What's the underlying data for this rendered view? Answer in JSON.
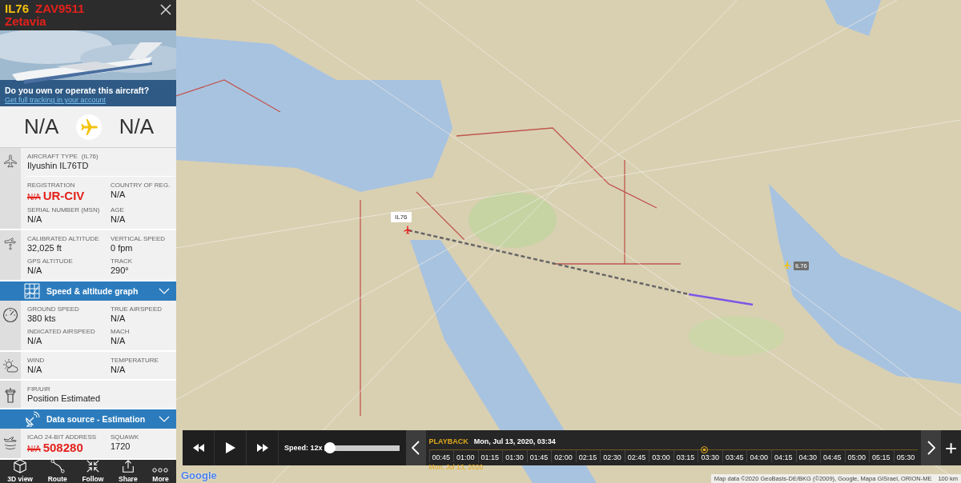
{
  "flight": {
    "aircraft_code": "IL76",
    "callsign": "ZAV9511",
    "airline": "Zetavia"
  },
  "banner": {
    "kind": "picture",
    "headline": "Do you own or operate this aircraft?",
    "link": "Get full tracking in your account"
  },
  "route": {
    "origin": "N/A",
    "destination": "N/A"
  },
  "sections": [
    {
      "kind": "details",
      "blocks": [
        [
          {
            "label": "AIRCRAFT TYPE",
            "label_extra": "(IL76)",
            "value": "Ilyushin IL76TD"
          }
        ],
        [
          {
            "label": "REGISTRATION",
            "struck": "N/A",
            "value": "UR-CIV",
            "edited": true
          },
          {
            "label": "COUNTRY OF REG.",
            "value": "N/A",
            "edited": false
          },
          {
            "label": "SERIAL NUMBER (MSN)",
            "value": "N/A",
            "edited": false
          },
          {
            "label": "AGE",
            "value": "N/A",
            "edited": false
          }
        ]
      ]
    },
    {
      "kind": "details",
      "blocks": [
        [
          {
            "label": "CALIBRATED ALTITUDE",
            "value": "32,025 ft",
            "edited": false
          },
          {
            "label": "VERTICAL SPEED",
            "value": "0 fpm",
            "edited": false
          },
          {
            "label": "GPS ALTITUDE",
            "value": "N/A",
            "edited": false
          },
          {
            "label": "TRACK",
            "value": "290°",
            "edited": false
          }
        ]
      ]
    },
    {
      "kind": "header",
      "title": "Speed & altitude graph"
    },
    {
      "kind": "details",
      "blocks": [
        [
          {
            "label": "GROUND SPEED",
            "value": "380 kts",
            "edited": false
          },
          {
            "label": "TRUE AIRSPEED",
            "value": "N/A",
            "edited": false
          },
          {
            "label": "INDICATED AIRSPEED",
            "value": "N/A",
            "edited": false
          },
          {
            "label": "MACH",
            "value": "N/A",
            "edited": false
          }
        ]
      ]
    },
    {
      "kind": "details",
      "blocks": [
        [
          {
            "label": "WIND",
            "value": "N/A",
            "edited": false
          },
          {
            "label": "TEMPERATURE",
            "value": "N/A",
            "edited": false
          }
        ]
      ]
    },
    {
      "kind": "details",
      "blocks": [
        [
          {
            "label": "FIR/UIR",
            "value": "Position Estimated"
          }
        ]
      ]
    },
    {
      "kind": "header",
      "title": "Data source - Estimation"
    },
    {
      "kind": "details",
      "blocks": [
        [
          {
            "label": "ICAO 24-BIT ADDRESS",
            "struck": "N/A",
            "value": "508280",
            "edited": true
          },
          {
            "label": "SQUAWK",
            "value": "1720",
            "edited": false
          }
        ]
      ]
    }
  ],
  "toolbar": [
    {
      "label": "3D view"
    },
    {
      "label": "Route"
    },
    {
      "label": "Follow"
    },
    {
      "label": "Share"
    },
    {
      "label": "More"
    }
  ],
  "map": {
    "kind": "picture",
    "aircraft_labels": [
      {
        "text": "IL76",
        "selected": true
      },
      {
        "text": "IL76",
        "selected": false
      }
    ],
    "attribution": "Map data ©2020 GeoBasis-DE/BKG (©2009), Google, Mapa GISrael, ORION-ME",
    "scale": "100 km",
    "logo": "Google",
    "zoom_in": "+"
  },
  "playback": {
    "speed_label": "Speed: 12x",
    "speed_slider": {
      "level": 0
    },
    "title": "PLAYBACK",
    "datetime": "Mon, Jul 13, 2020, 03:34",
    "date": "Mon, Jul 13, 2020",
    "playhead": {
      "level": 0.565
    },
    "ticks": [
      "00:45",
      "01:00",
      "01:15",
      "01:30",
      "01:45",
      "02:00",
      "02:15",
      "02:30",
      "02:45",
      "03:00",
      "03:15",
      "03:30",
      "03:45",
      "04:00",
      "04:15",
      "04:30",
      "04:45",
      "05:00",
      "05:15",
      "05:30"
    ]
  }
}
